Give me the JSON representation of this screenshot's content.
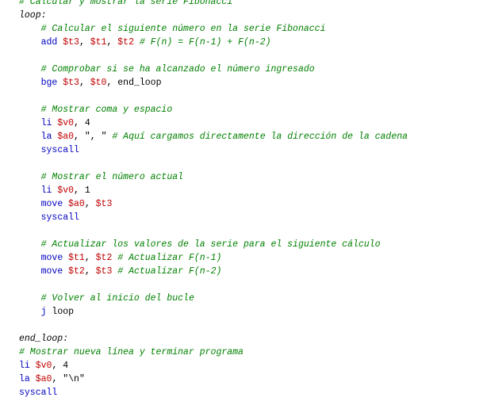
{
  "code": {
    "lines": [
      {
        "indent": "",
        "tokens": [
          {
            "t": "comment",
            "v": "# Calcular y mostrar la serie Fibonacci"
          }
        ]
      },
      {
        "indent": "",
        "tokens": [
          {
            "t": "label",
            "v": "loop:"
          }
        ]
      },
      {
        "indent": "    ",
        "tokens": [
          {
            "t": "comment",
            "v": "# Calcular el siguiente número en la serie Fibonacci"
          }
        ]
      },
      {
        "indent": "    ",
        "tokens": [
          {
            "t": "instr",
            "v": "add "
          },
          {
            "t": "reg",
            "v": "$t3"
          },
          {
            "t": "plain",
            "v": ", "
          },
          {
            "t": "reg",
            "v": "$t1"
          },
          {
            "t": "plain",
            "v": ", "
          },
          {
            "t": "reg",
            "v": "$t2"
          },
          {
            "t": "plain",
            "v": " "
          },
          {
            "t": "comment",
            "v": "# F(n) = F(n-1) + F(n-2)"
          }
        ]
      },
      {
        "indent": "",
        "tokens": []
      },
      {
        "indent": "    ",
        "tokens": [
          {
            "t": "comment",
            "v": "# Comprobar si se ha alcanzado el número ingresado"
          }
        ]
      },
      {
        "indent": "    ",
        "tokens": [
          {
            "t": "instr",
            "v": "bge "
          },
          {
            "t": "reg",
            "v": "$t3"
          },
          {
            "t": "plain",
            "v": ", "
          },
          {
            "t": "reg",
            "v": "$t0"
          },
          {
            "t": "plain",
            "v": ", end_loop"
          }
        ]
      },
      {
        "indent": "",
        "tokens": []
      },
      {
        "indent": "    ",
        "tokens": [
          {
            "t": "comment",
            "v": "# Mostrar coma y espacio"
          }
        ]
      },
      {
        "indent": "    ",
        "tokens": [
          {
            "t": "instr",
            "v": "li "
          },
          {
            "t": "reg",
            "v": "$v0"
          },
          {
            "t": "plain",
            "v": ", "
          },
          {
            "t": "num",
            "v": "4"
          }
        ]
      },
      {
        "indent": "    ",
        "tokens": [
          {
            "t": "instr",
            "v": "la "
          },
          {
            "t": "reg",
            "v": "$a0"
          },
          {
            "t": "plain",
            "v": ", "
          },
          {
            "t": "str",
            "v": "\", \""
          },
          {
            "t": "plain",
            "v": " "
          },
          {
            "t": "comment",
            "v": "# Aquí cargamos directamente la dirección de la cadena"
          }
        ]
      },
      {
        "indent": "    ",
        "tokens": [
          {
            "t": "instr",
            "v": "syscall"
          }
        ]
      },
      {
        "indent": "",
        "tokens": []
      },
      {
        "indent": "    ",
        "tokens": [
          {
            "t": "comment",
            "v": "# Mostrar el número actual"
          }
        ]
      },
      {
        "indent": "    ",
        "tokens": [
          {
            "t": "instr",
            "v": "li "
          },
          {
            "t": "reg",
            "v": "$v0"
          },
          {
            "t": "plain",
            "v": ", "
          },
          {
            "t": "num",
            "v": "1"
          }
        ]
      },
      {
        "indent": "    ",
        "tokens": [
          {
            "t": "instr",
            "v": "move "
          },
          {
            "t": "reg",
            "v": "$a0"
          },
          {
            "t": "plain",
            "v": ", "
          },
          {
            "t": "reg",
            "v": "$t3"
          }
        ]
      },
      {
        "indent": "    ",
        "tokens": [
          {
            "t": "instr",
            "v": "syscall"
          }
        ]
      },
      {
        "indent": "",
        "tokens": []
      },
      {
        "indent": "    ",
        "tokens": [
          {
            "t": "comment",
            "v": "# Actualizar los valores de la serie para el siguiente cálculo"
          }
        ]
      },
      {
        "indent": "    ",
        "tokens": [
          {
            "t": "instr",
            "v": "move "
          },
          {
            "t": "reg",
            "v": "$t1"
          },
          {
            "t": "plain",
            "v": ", "
          },
          {
            "t": "reg",
            "v": "$t2"
          },
          {
            "t": "plain",
            "v": " "
          },
          {
            "t": "comment",
            "v": "# Actualizar F(n-1)"
          }
        ]
      },
      {
        "indent": "    ",
        "tokens": [
          {
            "t": "instr",
            "v": "move "
          },
          {
            "t": "reg",
            "v": "$t2"
          },
          {
            "t": "plain",
            "v": ", "
          },
          {
            "t": "reg",
            "v": "$t3"
          },
          {
            "t": "plain",
            "v": " "
          },
          {
            "t": "comment",
            "v": "# Actualizar F(n-2)"
          }
        ]
      },
      {
        "indent": "",
        "tokens": []
      },
      {
        "indent": "    ",
        "tokens": [
          {
            "t": "comment",
            "v": "# Volver al inicio del bucle"
          }
        ]
      },
      {
        "indent": "    ",
        "tokens": [
          {
            "t": "instr",
            "v": "j "
          },
          {
            "t": "plain",
            "v": "loop"
          }
        ]
      },
      {
        "indent": "",
        "tokens": []
      },
      {
        "indent": "",
        "tokens": [
          {
            "t": "label",
            "v": "end_loop:"
          }
        ]
      },
      {
        "indent": "",
        "tokens": [
          {
            "t": "comment",
            "v": "# Mostrar nueva línea y terminar programa"
          }
        ]
      },
      {
        "indent": "",
        "tokens": [
          {
            "t": "instr",
            "v": "li "
          },
          {
            "t": "reg",
            "v": "$v0"
          },
          {
            "t": "plain",
            "v": ", "
          },
          {
            "t": "num",
            "v": "4"
          }
        ]
      },
      {
        "indent": "",
        "tokens": [
          {
            "t": "instr",
            "v": "la "
          },
          {
            "t": "reg",
            "v": "$a0"
          },
          {
            "t": "plain",
            "v": ", "
          },
          {
            "t": "str",
            "v": "\"\\n\""
          }
        ]
      },
      {
        "indent": "",
        "tokens": [
          {
            "t": "instr",
            "v": "syscall"
          }
        ]
      }
    ]
  },
  "colors": {
    "comment": "#008000",
    "instruction": "#0000c0",
    "register": "#c00000",
    "text": "#000000",
    "background": "#ffffff"
  }
}
